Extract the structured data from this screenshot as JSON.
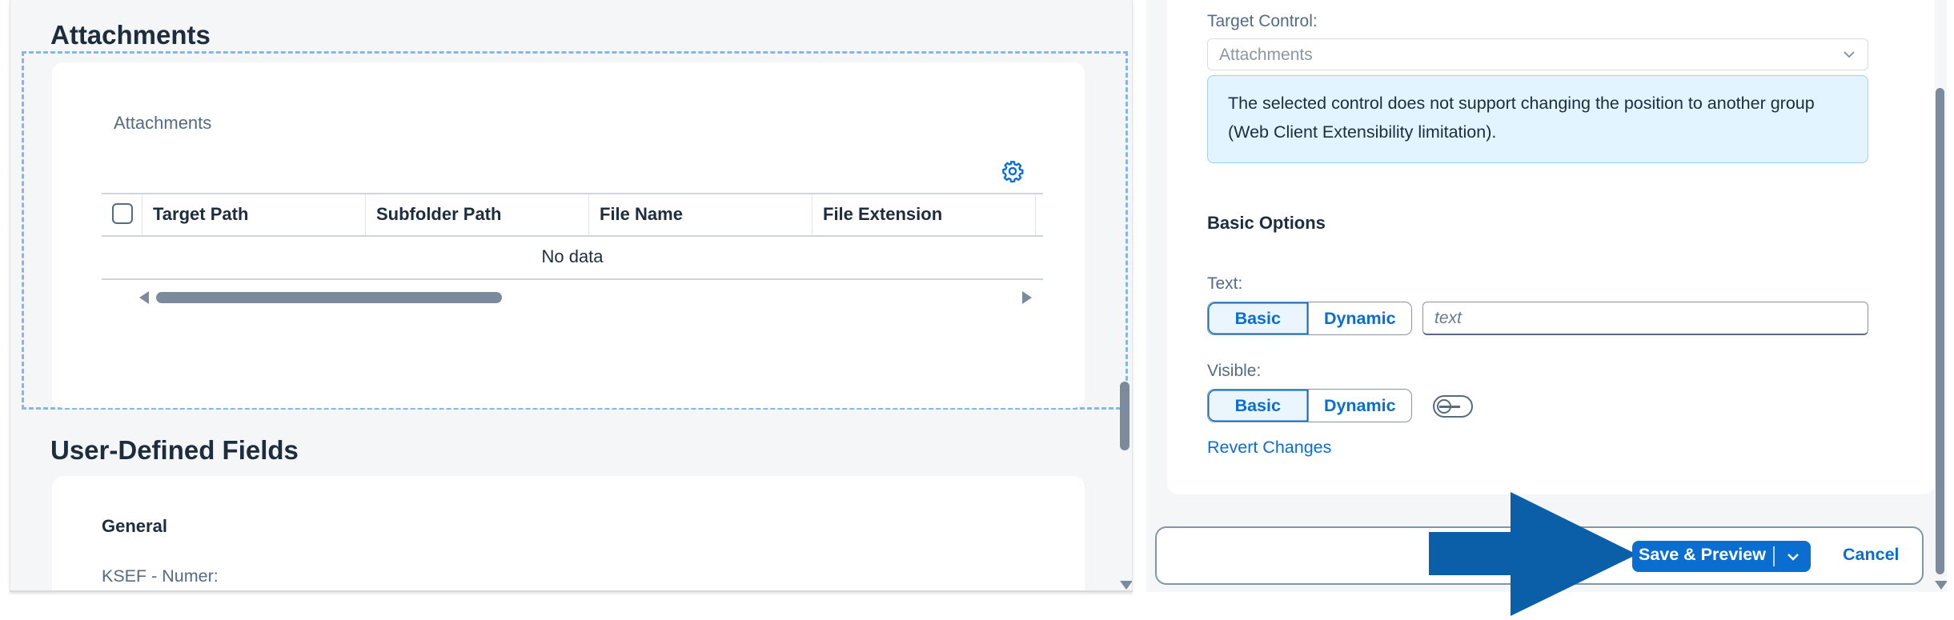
{
  "left": {
    "attachments_title": "Attachments",
    "attachments_card_label": "Attachments",
    "settings_icon": "gear-icon",
    "table": {
      "columns": [
        "Target Path",
        "Subfolder Path",
        "File Name",
        "File Extension"
      ],
      "empty_text": "No data"
    },
    "udf_title": "User-Defined Fields",
    "udf_group": "General",
    "udf_field_label": "KSEF - Numer:"
  },
  "right": {
    "target_control_label": "Target Control:",
    "target_control_value": "Attachments",
    "info_message": "The selected control does not support changing the position to another group (Web Client Extensibility limitation).",
    "basic_options_title": "Basic Options",
    "text_label": "Text:",
    "text_seg_basic": "Basic",
    "text_seg_dynamic": "Dynamic",
    "text_placeholder": "text",
    "visible_label": "Visible:",
    "visible_seg_basic": "Basic",
    "visible_seg_dynamic": "Dynamic",
    "revert_link": "Revert Changes",
    "footer": {
      "save_preview": "Save & Preview",
      "cancel": "Cancel"
    }
  },
  "colors": {
    "brand_blue": "#0a6ed1",
    "info_bg": "#e1f4ff",
    "arrow_blue": "#0b5ea8"
  }
}
